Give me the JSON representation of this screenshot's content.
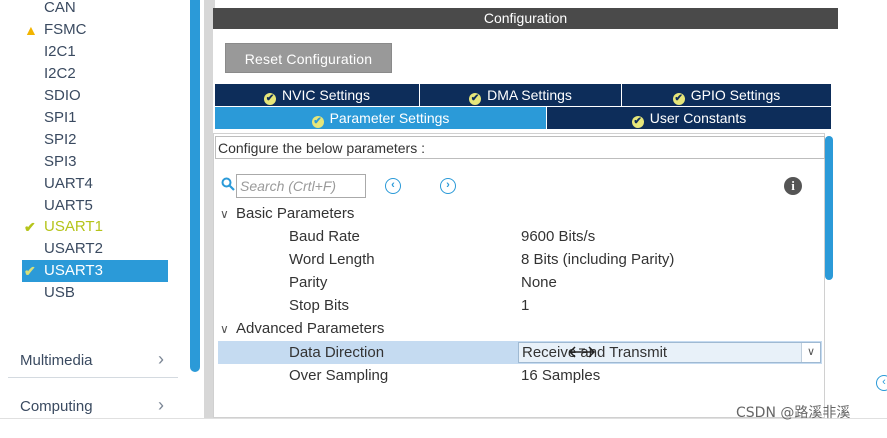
{
  "sidebar": {
    "peripherals": [
      {
        "label": "CAN",
        "status": "none",
        "selected": false
      },
      {
        "label": "FSMC",
        "status": "warning",
        "selected": false
      },
      {
        "label": "I2C1",
        "status": "none",
        "selected": false
      },
      {
        "label": "I2C2",
        "status": "none",
        "selected": false
      },
      {
        "label": "SDIO",
        "status": "none",
        "selected": false
      },
      {
        "label": "SPI1",
        "status": "none",
        "selected": false
      },
      {
        "label": "SPI2",
        "status": "none",
        "selected": false
      },
      {
        "label": "SPI3",
        "status": "none",
        "selected": false
      },
      {
        "label": "UART4",
        "status": "none",
        "selected": false
      },
      {
        "label": "UART5",
        "status": "none",
        "selected": false
      },
      {
        "label": "USART1",
        "status": "configured",
        "selected": false
      },
      {
        "label": "USART2",
        "status": "none",
        "selected": false
      },
      {
        "label": "USART3",
        "status": "configured",
        "selected": true
      },
      {
        "label": "USB",
        "status": "none",
        "selected": false
      }
    ],
    "categories": [
      {
        "label": "Multimedia"
      },
      {
        "label": "Computing"
      }
    ]
  },
  "config": {
    "header": "Configuration",
    "reset_label": "Reset Configuration",
    "tabs_top": [
      {
        "label": "NVIC Settings"
      },
      {
        "label": "DMA Settings"
      },
      {
        "label": "GPIO Settings"
      }
    ],
    "tabs_bottom": [
      {
        "label": "Parameter Settings",
        "active": true
      },
      {
        "label": "User Constants",
        "active": false
      }
    ],
    "caption": "Configure the below parameters :",
    "search": {
      "placeholder": "Search (Crtl+F)",
      "value": ""
    },
    "groups": [
      {
        "label": "Basic Parameters",
        "expanded": true,
        "params": [
          {
            "name": "Baud Rate",
            "value": "9600 Bits/s"
          },
          {
            "name": "Word Length",
            "value": "8 Bits (including Parity)"
          },
          {
            "name": "Parity",
            "value": "None"
          },
          {
            "name": "Stop Bits",
            "value": "1"
          }
        ]
      },
      {
        "label": "Advanced Parameters",
        "expanded": true,
        "params": [
          {
            "name": "Data Direction",
            "value": "Receive and Transmit",
            "editing": true
          },
          {
            "name": "Over Sampling",
            "value": "16 Samples"
          }
        ]
      }
    ]
  },
  "watermark": "CSDN @路溪非溪",
  "colors": {
    "accent": "#2b9ad8",
    "tab_dark": "#0d2d5a",
    "header_dark": "#4a4a4a",
    "warning": "#f2b400",
    "configured": "#b5c41a",
    "row_highlight": "#c5dbf1"
  }
}
